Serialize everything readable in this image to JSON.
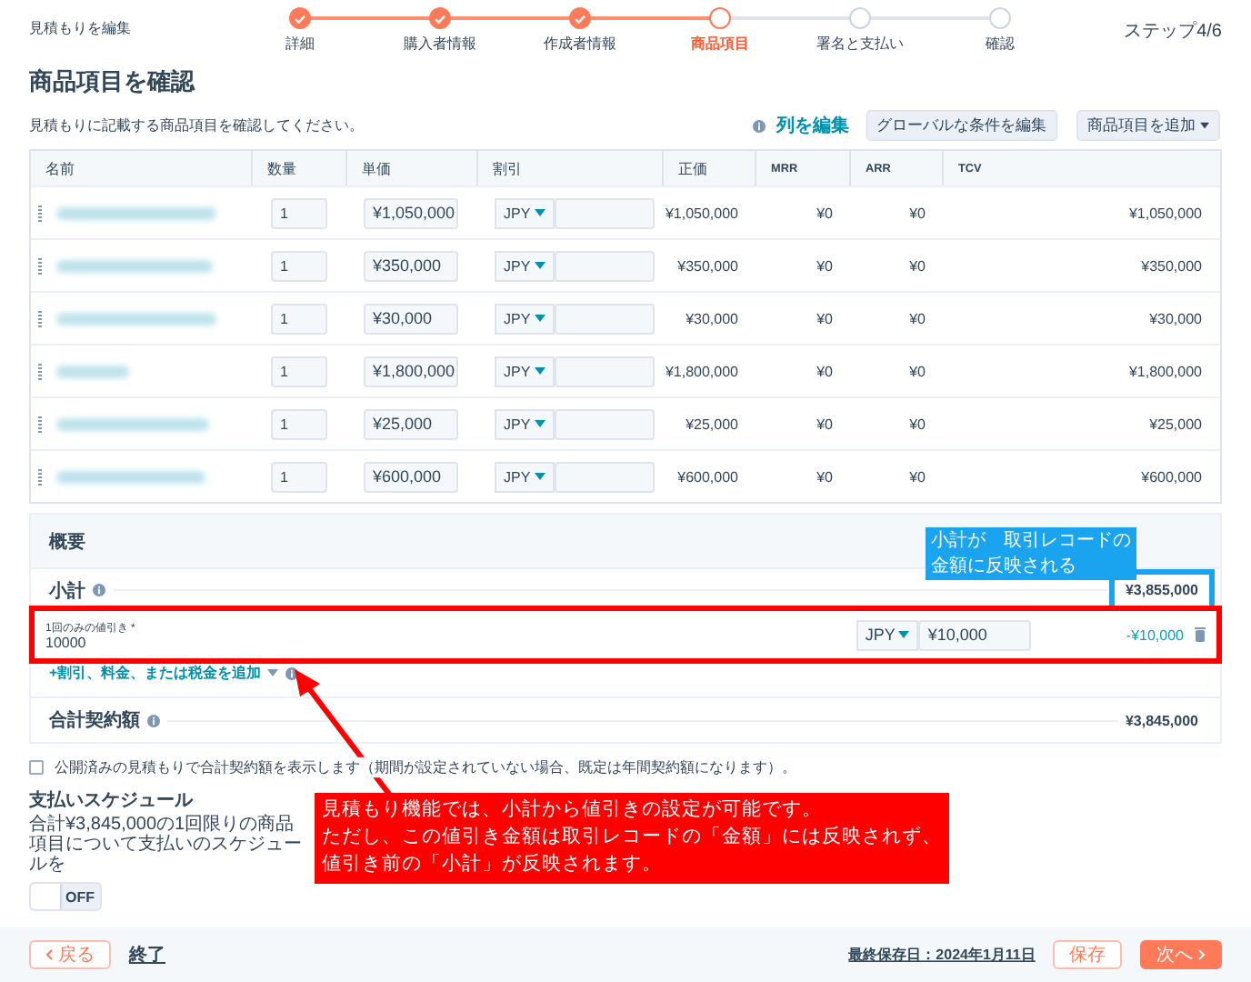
{
  "header": {
    "title": "見積もりを編集",
    "step_counter": "ステップ4/6"
  },
  "steps": [
    {
      "label": "詳細",
      "completed": true,
      "selected": false
    },
    {
      "label": "購入者情報",
      "completed": true,
      "selected": false
    },
    {
      "label": "作成者情報",
      "completed": true,
      "selected": false
    },
    {
      "label": "商品項目",
      "completed": false,
      "selected": true
    },
    {
      "label": "署名と支払い",
      "completed": false,
      "selected": false
    },
    {
      "label": "確認",
      "completed": false,
      "selected": false
    }
  ],
  "section": {
    "title": "商品項目を確認",
    "description": "見積もりに記載する商品項目を確認してください。",
    "edit_columns_link": "列を編集",
    "buttons": [
      {
        "label": "グローバルな条件を編集",
        "kind": "plain"
      },
      {
        "label": "商品項目を追加",
        "kind": "dropdown"
      }
    ]
  },
  "table": {
    "columns": [
      "名前",
      "数量",
      "単価",
      "割引",
      "正価",
      "MRR",
      "ARR",
      "TCV"
    ],
    "rows": [
      {
        "quantity": "1",
        "unit_price": "¥1,050,000",
        "discount_currency": "JPY",
        "list_price": "¥1,050,000",
        "mrr": "¥0",
        "arr": "¥0",
        "tcv": "¥1,050,000"
      },
      {
        "quantity": "1",
        "unit_price": "¥350,000",
        "discount_currency": "JPY",
        "list_price": "¥350,000",
        "mrr": "¥0",
        "arr": "¥0",
        "tcv": "¥350,000"
      },
      {
        "quantity": "1",
        "unit_price": "¥30,000",
        "discount_currency": "JPY",
        "list_price": "¥30,000",
        "mrr": "¥0",
        "arr": "¥0",
        "tcv": "¥30,000"
      },
      {
        "quantity": "1",
        "unit_price": "¥1,800,000",
        "discount_currency": "JPY",
        "list_price": "¥1,800,000",
        "mrr": "¥0",
        "arr": "¥0",
        "tcv": "¥1,800,000"
      },
      {
        "quantity": "1",
        "unit_price": "¥25,000",
        "discount_currency": "JPY",
        "list_price": "¥25,000",
        "mrr": "¥0",
        "arr": "¥0",
        "tcv": "¥25,000"
      },
      {
        "quantity": "1",
        "unit_price": "¥600,000",
        "discount_currency": "JPY",
        "list_price": "¥600,000",
        "mrr": "¥0",
        "arr": "¥0",
        "tcv": "¥600,000"
      }
    ]
  },
  "summary": {
    "title": "概要",
    "subtotal_label": "小計",
    "subtotal": "¥3,855,000",
    "discount": {
      "label": "1回のみの値引き *",
      "value": "10000",
      "currency": "JPY",
      "amount": "¥10,000",
      "result": "-¥10,000"
    },
    "add_link": "+割引、料金、または税金を追加",
    "total_label": "合計契約額",
    "total": "¥3,845,000"
  },
  "show_total": {
    "label": "公開済みの見積もりで合計契約額を表示します（期間が設定されていない場合、既定は年間契約額になります）。",
    "checked": false
  },
  "payment": {
    "title": "支払いスケジュール",
    "description": "合計¥3,845,000の1回限りの商品項目について支払いのスケジュールを",
    "toggle": {
      "label": "OFF",
      "on": false
    }
  },
  "footer": {
    "back": "戻る",
    "exit": "終了",
    "last_saved": "最終保存日：2024年1月11日",
    "save": "保存",
    "next": "次へ"
  },
  "annotations": [
    {
      "kind": "subtotal_note",
      "color": "#1aa3ef",
      "lines": [
        "小計が　取引レコードの",
        "金額に反映される"
      ]
    },
    {
      "kind": "discount_note",
      "color": "#ff0000",
      "lines": [
        "見積もり機能では、小計から値引きの設定が可能です。",
        "ただし、この値引き金額は取引レコードの「金額」には反映されず、",
        "値引き前の「小計」が反映されます。"
      ]
    }
  ]
}
